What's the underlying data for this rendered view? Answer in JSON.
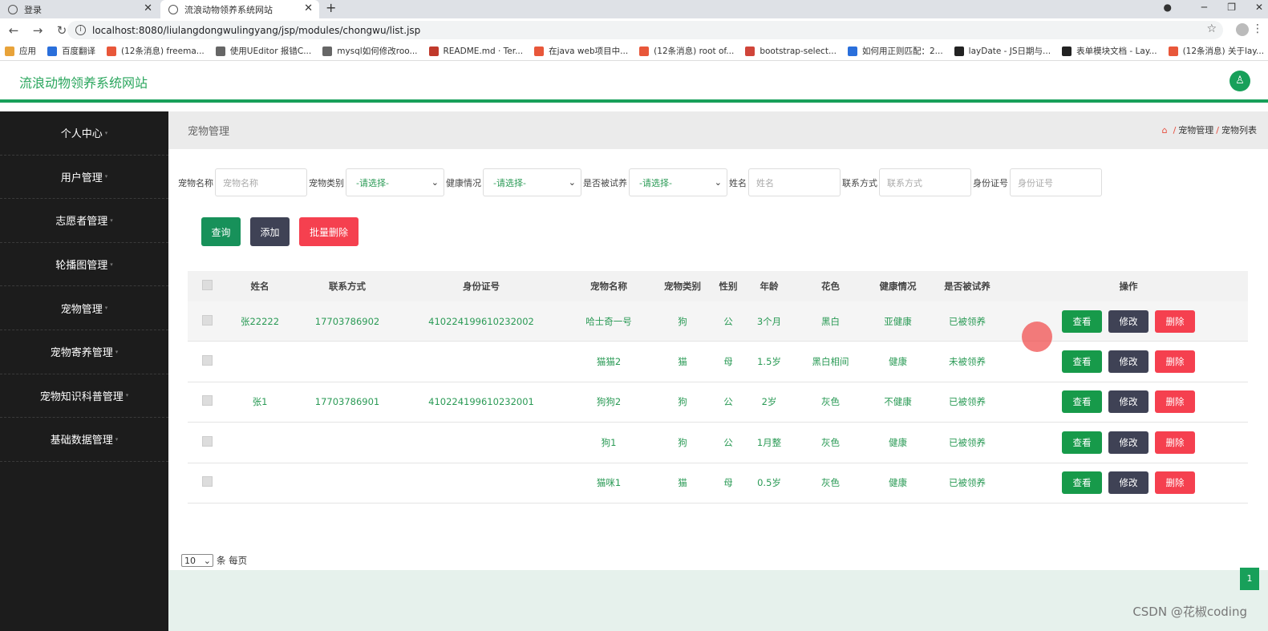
{
  "browser": {
    "tabs": [
      {
        "label": "登录",
        "close": "✕"
      },
      {
        "label": "流浪动物领养系统网站",
        "close": "✕"
      }
    ],
    "new_tab": "+",
    "window_controls": {
      "minimize": "─",
      "restore": "❐",
      "close": "✕"
    },
    "nav": {
      "back": "←",
      "forward": "→",
      "reload": "↻"
    },
    "url": "localhost:8080/liulangdongwulingyang/jsp/modules/chongwu/list.jsp",
    "bookmarks": [
      "应用",
      "百度翻译",
      "(12条消息) freema...",
      "使用UEditor 报错C...",
      "mysql如何修改roo...",
      "README.md · Ter...",
      "在java web项目中...",
      "(12条消息) root of...",
      "bootstrap-select...",
      "如何用正则匹配：2...",
      "layDate - JS日期与...",
      "表单模块文档 - Lay...",
      "(12条消息) 关于lay..."
    ]
  },
  "app": {
    "title": "流浪动物领养系统网站",
    "avatar_icon": "user-icon"
  },
  "sidebar": {
    "items": [
      "个人中心",
      "用户管理",
      "志愿者管理",
      "轮播图管理",
      "宠物管理",
      "宠物寄养管理",
      "宠物知识科普管理",
      "基础数据管理"
    ],
    "caret": "▾"
  },
  "page": {
    "title": "宠物管理",
    "breadcrumb": [
      "宠物管理",
      "宠物列表"
    ],
    "sep": "/"
  },
  "filters": {
    "pet_name": {
      "label": "宠物名称",
      "placeholder": "宠物名称"
    },
    "pet_type": {
      "label": "宠物类别",
      "value": "-请选择-"
    },
    "health": {
      "label": "健康情况",
      "value": "-请选择-"
    },
    "adopted": {
      "label": "是否被试养",
      "value": "-请选择-"
    },
    "name": {
      "label": "姓名",
      "placeholder": "姓名"
    },
    "phone": {
      "label": "联系方式",
      "placeholder": "联系方式"
    },
    "idcard": {
      "label": "身份证号",
      "placeholder": "身份证号"
    }
  },
  "actions": {
    "query": "查询",
    "add": "添加",
    "batch_delete": "批量删除"
  },
  "table": {
    "headers": [
      "姓名",
      "联系方式",
      "身份证号",
      "宠物名称",
      "宠物类别",
      "性别",
      "年龄",
      "花色",
      "健康情况",
      "是否被试养",
      "操作"
    ],
    "rows": [
      [
        "张22222",
        "17703786902",
        "410224199610232002",
        "哈士奇一号",
        "狗",
        "公",
        "3个月",
        "黑白",
        "亚健康",
        "已被领养"
      ],
      [
        "",
        "",
        "",
        "猫猫2",
        "猫",
        "母",
        "1.5岁",
        "黑白相间",
        "健康",
        "未被领养"
      ],
      [
        "张1",
        "17703786901",
        "410224199610232001",
        "狗狗2",
        "狗",
        "公",
        "2岁",
        "灰色",
        "不健康",
        "已被领养"
      ],
      [
        "",
        "",
        "",
        "狗1",
        "狗",
        "公",
        "1月整",
        "灰色",
        "健康",
        "已被领养"
      ],
      [
        "",
        "",
        "",
        "猫咪1",
        "猫",
        "母",
        "0.5岁",
        "灰色",
        "健康",
        "已被领养"
      ]
    ],
    "row_actions": {
      "view": "查看",
      "edit": "修改",
      "delete": "删除"
    }
  },
  "pagination": {
    "page_size": "10",
    "per_page_label": "条 每页",
    "current_page": "1"
  },
  "watermark": "CSDN @花椒coding"
}
